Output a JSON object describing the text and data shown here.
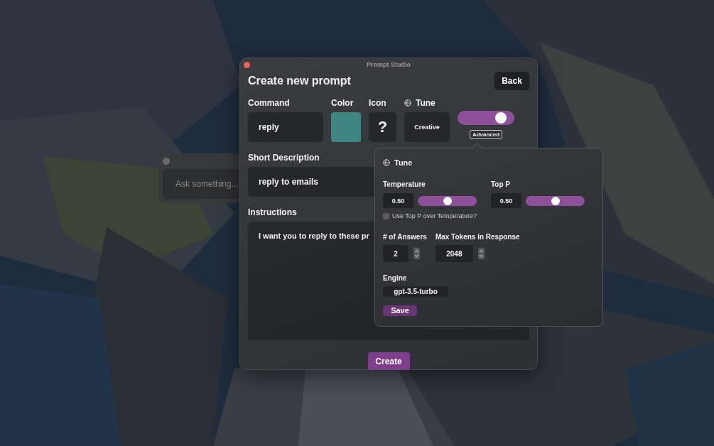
{
  "assistant_window": {
    "placeholder": "Ask something..."
  },
  "window": {
    "title": "Prompt Studio"
  },
  "heading": "Create new prompt",
  "back_button": "Back",
  "command": {
    "label": "Command",
    "value": "reply"
  },
  "color": {
    "label": "Color",
    "color": "#3f8582"
  },
  "icon": {
    "label": "Icon",
    "value": "?"
  },
  "tune": {
    "label": "Tune",
    "value": "Creative",
    "advanced": {
      "on": true,
      "label": "Advanced"
    }
  },
  "short_description": {
    "label": "Short Description",
    "value": "reply to emails"
  },
  "instructions": {
    "label": "Instructions",
    "value": "I want you to reply to these pr"
  },
  "create_button": "Create",
  "tune_popover": {
    "title": "Tune",
    "temperature": {
      "label": "Temperature",
      "value": "0.50",
      "level": 0.5
    },
    "top_p": {
      "label": "Top P",
      "value": "0.50",
      "level": 0.5
    },
    "use_top_p": {
      "label": "Use Top P over Temperature?",
      "checked": false
    },
    "answers": {
      "label": "# of Answers",
      "value": "2"
    },
    "max_tokens": {
      "label": "Max Tokens in Response",
      "value": "2048"
    },
    "engine": {
      "label": "Engine",
      "value": "gpt-3.5-turbo"
    },
    "save_button": "Save"
  }
}
